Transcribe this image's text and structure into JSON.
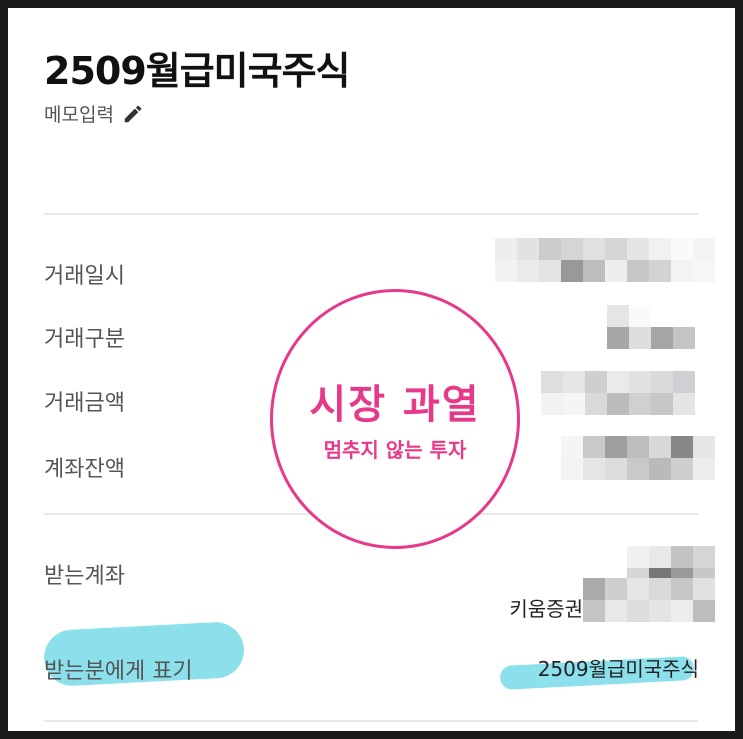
{
  "header": {
    "title": "2509월급미국주식",
    "memo_label": "메모입력",
    "memo_icon": "pencil-icon"
  },
  "details": {
    "trade_datetime_label": "거래일시",
    "trade_type_label": "거래구분",
    "trade_amount_label": "거래금액",
    "account_balance_label": "계좌잔액"
  },
  "recipient": {
    "receiving_account_label": "받는계좌",
    "bank_name": "키움증권",
    "recipient_display_label": "받는분에게 표기",
    "recipient_display_value": "2509월급미국주식"
  },
  "overlay": {
    "main_text": "시장 과열",
    "sub_text": "멈추지 않는 투자",
    "accent_color": "#e6398a"
  },
  "highlight_color": "#66d5e6"
}
